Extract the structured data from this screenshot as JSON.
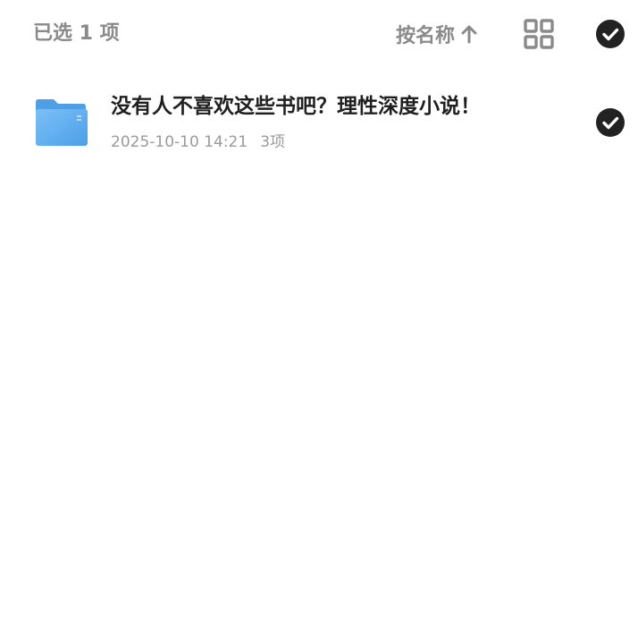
{
  "toolbar": {
    "selected_label": "已选 1 项",
    "sort_label": "按名称",
    "sort_icon": "arrow-up-icon",
    "view_icon": "grid-view-icon",
    "select_all_icon": "check-circle-icon"
  },
  "files": [
    {
      "name": "没有人不喜欢这些书吧？理性深度小说！",
      "date": "2025-10-10 14:21",
      "count": "3项",
      "icon": "folder-icon",
      "selected": true
    }
  ],
  "colors": {
    "muted_text": "#8a8a8a",
    "primary_text": "#1f1f1f",
    "check_fill": "#222222",
    "folder_blue": "#5aaaf0"
  }
}
